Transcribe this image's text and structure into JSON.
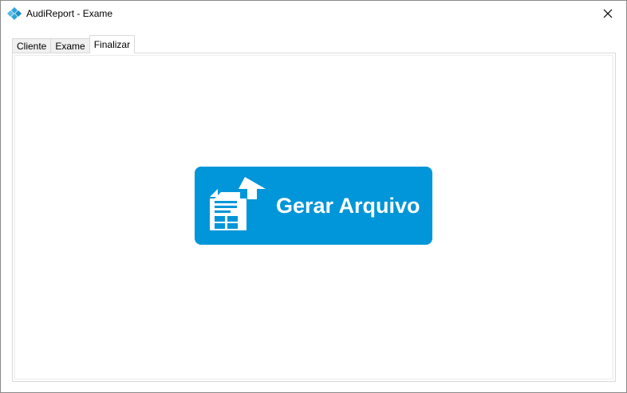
{
  "window": {
    "title": "AudiReport - Exame",
    "close_glyph": "✕"
  },
  "tabs": [
    {
      "label": "Cliente",
      "active": false
    },
    {
      "label": "Exame",
      "active": false
    },
    {
      "label": "Finalizar",
      "active": true
    }
  ],
  "main": {
    "generate_button": {
      "label": "Gerar Arquivo",
      "icon": "document-upload-icon",
      "color": "#0096d9"
    }
  },
  "colors": {
    "accent": "#0096d9",
    "app_icon": "#2fa4d8"
  }
}
